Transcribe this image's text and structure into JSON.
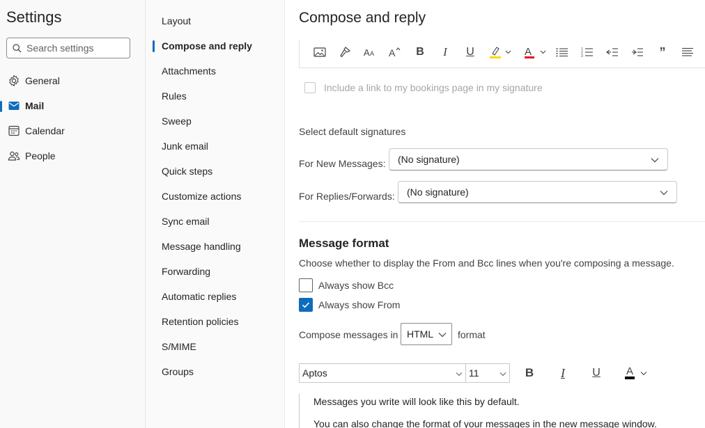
{
  "left_nav": {
    "title": "Settings",
    "search_placeholder": "Search settings",
    "items": [
      {
        "label": "General",
        "icon": "gear-icon"
      },
      {
        "label": "Mail",
        "icon": "mail-icon",
        "active": true
      },
      {
        "label": "Calendar",
        "icon": "calendar-icon"
      },
      {
        "label": "People",
        "icon": "people-icon"
      }
    ]
  },
  "mail_nav": {
    "items": [
      "Layout",
      "Compose and reply",
      "Attachments",
      "Rules",
      "Sweep",
      "Junk email",
      "Quick steps",
      "Customize actions",
      "Sync email",
      "Message handling",
      "Forwarding",
      "Automatic replies",
      "Retention policies",
      "S/MIME",
      "Groups"
    ],
    "active": "Compose and reply"
  },
  "content": {
    "title": "Compose and reply",
    "signature_toolbar": [
      "insert-picture-icon",
      "format-painter-icon",
      "font-size-icon",
      "grow-font-icon",
      "bold-icon",
      "italic-icon",
      "underline-icon",
      "highlight-icon",
      "font-color-icon",
      "bullets-icon",
      "numbering-icon",
      "decrease-indent-icon",
      "increase-indent-icon",
      "quote-icon",
      "align-icon"
    ],
    "bookings_link": {
      "label": "Include a link to my bookings page in my signature",
      "checked": false,
      "disabled": true
    },
    "default_signatures": {
      "section_label": "Select default signatures",
      "new_messages_label": "For New Messages:",
      "new_messages_value": "(No signature)",
      "replies_label": "For Replies/Forwards:",
      "replies_value": "(No signature)"
    },
    "message_format": {
      "title": "Message format",
      "description": "Choose whether to display the From and Bcc lines when you're composing a message.",
      "always_show_bcc": {
        "label": "Always show Bcc",
        "checked": false
      },
      "always_show_from": {
        "label": "Always show From",
        "checked": true
      },
      "compose_label": "Compose messages in",
      "format_value": "HTML",
      "format_suffix": "format"
    },
    "font_toolbar": {
      "font_name": "Aptos",
      "font_size": "11",
      "bold_glyph": "B",
      "italic_glyph": "I",
      "underline_glyph": "U",
      "font_color_glyph": "A"
    },
    "preview": {
      "line1": "Messages you write will look like this by default.",
      "line2": "You can also change the format of your messages in the new message window."
    }
  },
  "colors": {
    "accent": "#0f6cbd",
    "highlight": "#ffd800",
    "font_color": "#e81123"
  }
}
